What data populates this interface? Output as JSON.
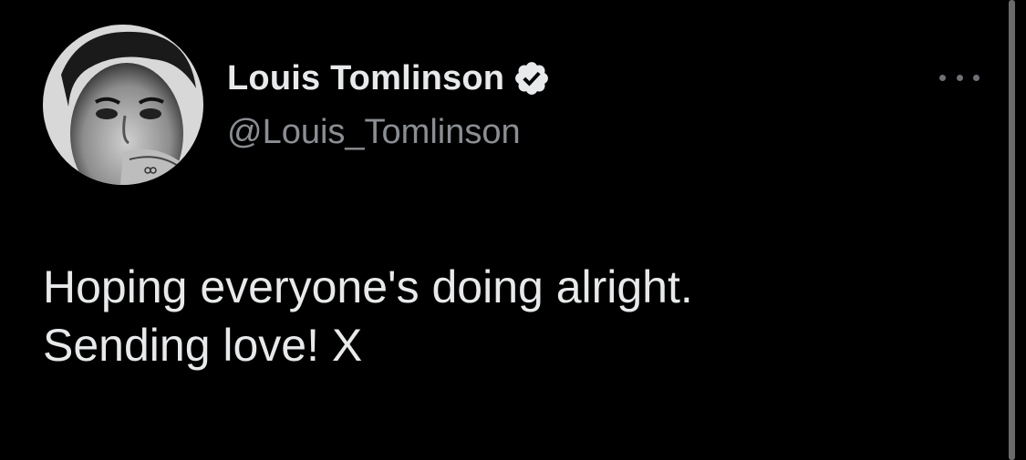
{
  "tweet": {
    "author": {
      "display_name": "Louis Tomlinson",
      "handle": "@Louis_Tomlinson",
      "verified_icon": "verified-badge-icon",
      "avatar_icon": "profile-photo"
    },
    "more_icon": "more-options-icon",
    "text_lines": [
      "Hoping everyone's doing alright.",
      "Sending love! X"
    ]
  },
  "colors": {
    "background": "#000000",
    "primary_text": "#e7e9ea",
    "secondary_text": "#8b8e92",
    "verified_badge": "#e7e9ea"
  }
}
